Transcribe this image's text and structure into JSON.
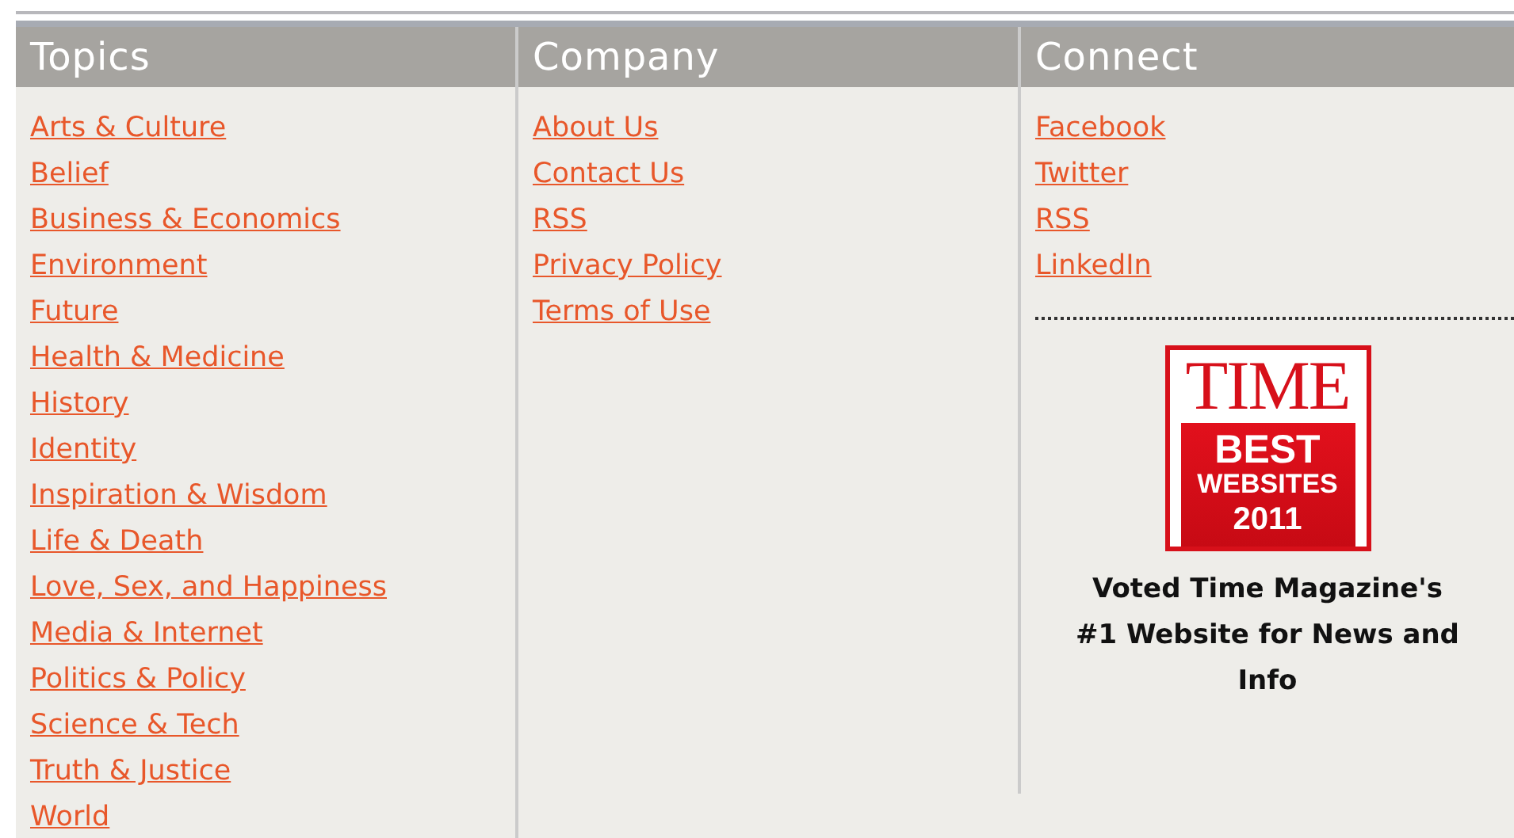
{
  "columns": [
    {
      "title": "Topics",
      "links": [
        "Arts & Culture",
        "Belief",
        "Business & Economics",
        "Environment",
        "Future",
        "Health & Medicine",
        "History",
        "Identity",
        "Inspiration & Wisdom",
        "Life & Death",
        "Love, Sex, and Happiness",
        "Media & Internet",
        "Politics & Policy",
        "Science & Tech",
        "Truth & Justice",
        "World"
      ]
    },
    {
      "title": "Company",
      "links": [
        "About Us",
        "Contact Us",
        "RSS",
        "Privacy Policy",
        "Terms of Use"
      ]
    },
    {
      "title": "Connect",
      "links": [
        "Facebook",
        "Twitter",
        "RSS",
        "LinkedIn"
      ],
      "badge": {
        "brand": "TIME",
        "line_1": "BEST",
        "line_2": "WEBSITES",
        "year": "2011",
        "caption": "Voted Time Magazine's #1 Website for News and Info"
      }
    }
  ]
}
